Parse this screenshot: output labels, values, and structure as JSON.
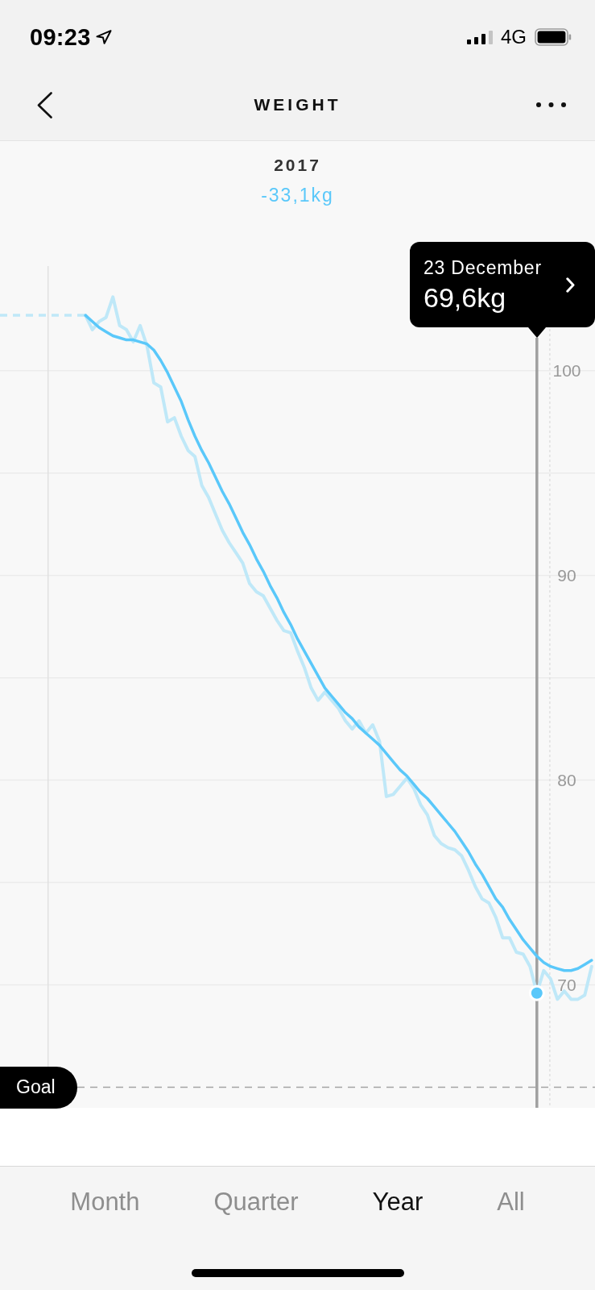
{
  "status_bar": {
    "time": "09:23",
    "network": "4G"
  },
  "header": {
    "title": "WEIGHT"
  },
  "summary": {
    "period": "2017",
    "change": "-33,1kg"
  },
  "chart": {
    "tooltip": {
      "date": "23 December",
      "value": "69,6kg"
    },
    "chart_data": {
      "type": "line",
      "grid": true,
      "categories": [
        null,
        null,
        null,
        null,
        null,
        null,
        null,
        null,
        null,
        null,
        null,
        null,
        null,
        null,
        null,
        null,
        null,
        null,
        null,
        null,
        null,
        null,
        null,
        null,
        null,
        null,
        null,
        null,
        null,
        null,
        null,
        null,
        null,
        null,
        null,
        null,
        null,
        null,
        null,
        null,
        null,
        null,
        null,
        null,
        null,
        null,
        null,
        null,
        null,
        null,
        null,
        null,
        null,
        null,
        null,
        null,
        null,
        null,
        null,
        null,
        null,
        null,
        null,
        null,
        null,
        null,
        null,
        null,
        null,
        null,
        null,
        null,
        null,
        null,
        null,
        null,
        null,
        null,
        null,
        null,
        null,
        null,
        null,
        null,
        null,
        null,
        null
      ],
      "series": [
        {
          "color": "#bfe8f8",
          "values": [
            null,
            null,
            null,
            null,
            null,
            null,
            null,
            null,
            null,
            null,
            null,
            null,
            102.7,
            102.0,
            102.4,
            102.6,
            103.6,
            102.2,
            102.0,
            101.4,
            102.2,
            101.2,
            99.4,
            99.2,
            97.5,
            97.7,
            96.8,
            96.1,
            95.8,
            94.4,
            93.8,
            93.0,
            92.2,
            91.6,
            91.1,
            90.6,
            89.6,
            89.2,
            89.0,
            88.4,
            87.8,
            87.3,
            87.2,
            86.3,
            85.5,
            84.5,
            83.9,
            84.3,
            83.9,
            83.5,
            82.9,
            82.5,
            82.9,
            82.3,
            82.7,
            81.9,
            79.2,
            79.3,
            79.7,
            80.1,
            79.6,
            78.8,
            78.3,
            77.3,
            76.9,
            76.7,
            76.6,
            76.3,
            75.6,
            74.8,
            74.2,
            74.0,
            73.3,
            72.3,
            72.3,
            71.6,
            71.5,
            70.9,
            69.6,
            70.7,
            70.3,
            69.3,
            69.7,
            69.3,
            69.3,
            69.5,
            70.9
          ]
        },
        {
          "color": "#5ac8fa",
          "values": [
            null,
            null,
            null,
            null,
            null,
            null,
            null,
            null,
            null,
            null,
            null,
            null,
            102.7,
            102.4,
            102.1,
            101.9,
            101.7,
            101.6,
            101.5,
            101.5,
            101.4,
            101.3,
            101.0,
            100.5,
            99.9,
            99.2,
            98.5,
            97.6,
            96.8,
            96.1,
            95.5,
            94.8,
            94.1,
            93.5,
            92.8,
            92.1,
            91.5,
            90.8,
            90.2,
            89.5,
            88.9,
            88.2,
            87.6,
            86.9,
            86.3,
            85.7,
            85.1,
            84.5,
            84.1,
            83.7,
            83.3,
            83.0,
            82.6,
            82.3,
            82.0,
            81.7,
            81.3,
            80.9,
            80.5,
            80.2,
            79.8,
            79.4,
            79.1,
            78.7,
            78.3,
            77.9,
            77.5,
            77.0,
            76.5,
            75.9,
            75.4,
            74.8,
            74.2,
            73.8,
            73.2,
            72.7,
            72.2,
            71.8,
            71.4,
            71.1,
            70.9,
            70.8,
            70.7,
            70.7,
            70.8,
            71.0,
            71.2
          ]
        },
        {
          "color": "#5ac8fa",
          "marker": "circle",
          "values": [
            null,
            null,
            null,
            null,
            null,
            null,
            null,
            null,
            null,
            null,
            null,
            null,
            null,
            null,
            null,
            null,
            null,
            null,
            null,
            null,
            null,
            null,
            null,
            null,
            null,
            null,
            null,
            null,
            null,
            null,
            null,
            null,
            null,
            null,
            null,
            null,
            null,
            null,
            null,
            null,
            null,
            null,
            null,
            null,
            null,
            null,
            null,
            null,
            null,
            null,
            null,
            null,
            null,
            null,
            null,
            null,
            null,
            null,
            null,
            null,
            null,
            null,
            null,
            null,
            null,
            null,
            null,
            null,
            null,
            null,
            null,
            null,
            null,
            null,
            null,
            null,
            null,
            null,
            69.6,
            null,
            null,
            null,
            null,
            null,
            null,
            null,
            null
          ]
        }
      ],
      "ylim": [
        55.1,
        118.1
      ],
      "yticks": [
        70,
        80,
        90,
        100
      ],
      "ref_lines": [
        {
          "axis": "y",
          "value": 102.7
        },
        {
          "axis": "y",
          "value": 65,
          "label": "Goal"
        }
      ]
    }
  },
  "range_tabs": [
    {
      "label": "Month",
      "selected": false
    },
    {
      "label": "Quarter",
      "selected": false
    },
    {
      "label": "Year",
      "selected": true
    },
    {
      "label": "All",
      "selected": false
    }
  ]
}
